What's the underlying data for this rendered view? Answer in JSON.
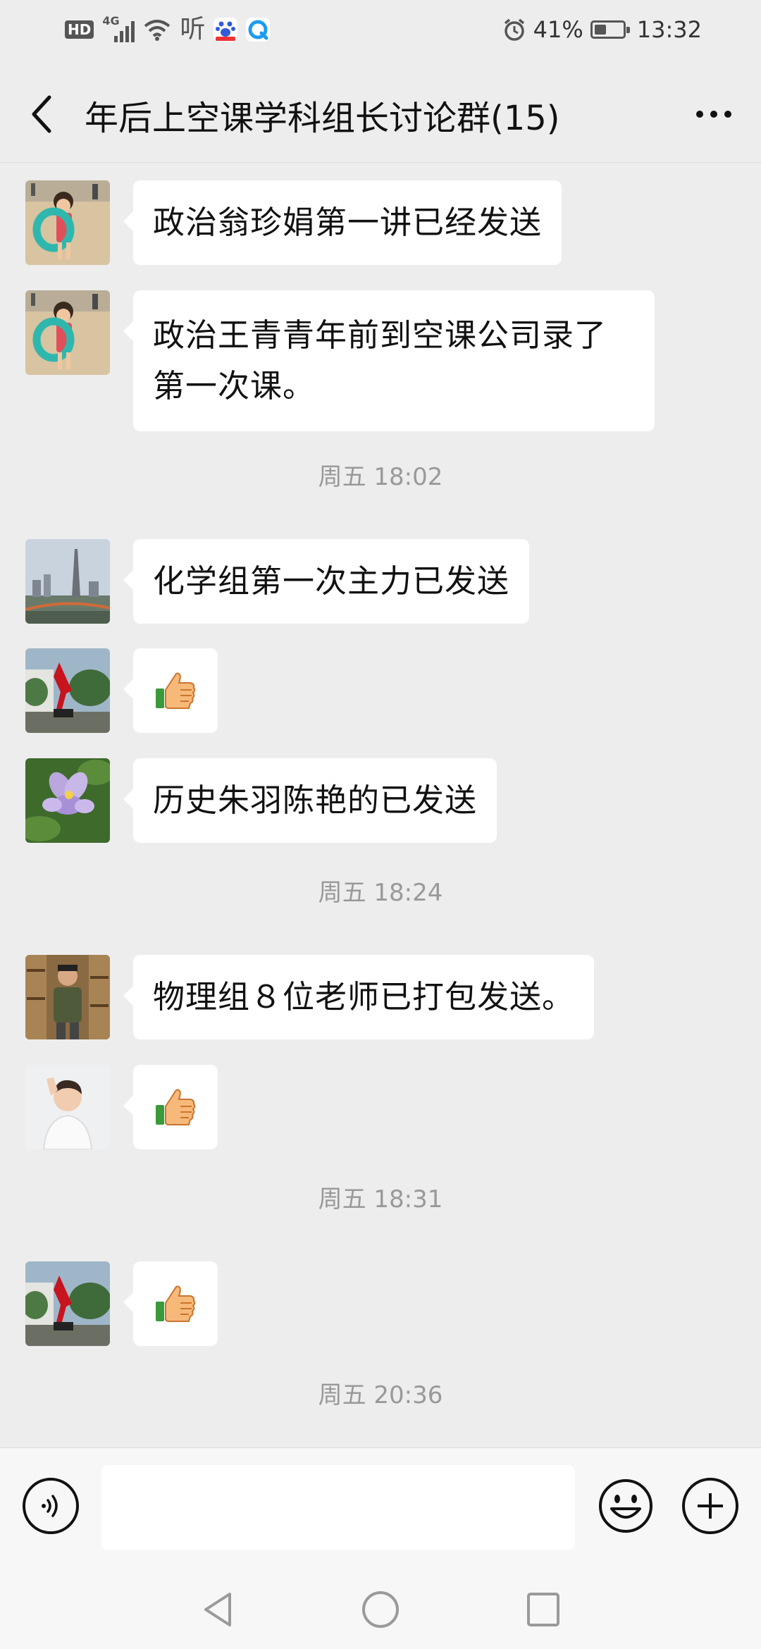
{
  "status_bar": {
    "network_badge": "HD",
    "signal_type": "4G",
    "app_glyph": "听",
    "icons": [
      "hd-icon",
      "signal-icon",
      "wifi-icon",
      "ting-app-icon",
      "baidu-app-icon",
      "browser-app-icon",
      "alarm-icon",
      "battery-icon"
    ],
    "battery_percent": "41%",
    "battery_level": 0.41,
    "time": "13:32"
  },
  "header": {
    "title": "年后上空课学科组长讨论群(15)",
    "back_icon": "chevron-left-icon",
    "more_icon": "more-dots-icon"
  },
  "messages": [
    {
      "type": "text",
      "avatar": "child-beach-avatar",
      "text": "政治翁珍娟第一讲已经发送"
    },
    {
      "type": "text",
      "avatar": "child-beach-avatar",
      "text": "政治王青青年前到空课公司录了第一次课。"
    },
    {
      "type": "time",
      "text": "周五 18:02"
    },
    {
      "type": "text",
      "avatar": "city-tower-avatar",
      "text": "化学组第一次主力已发送"
    },
    {
      "type": "emoji",
      "avatar": "red-sculpture-avatar",
      "emoji": "thumbs-up-emoji"
    },
    {
      "type": "text",
      "avatar": "purple-flower-avatar",
      "text": "历史朱羽陈艳的已发送"
    },
    {
      "type": "time",
      "text": "周五 18:24"
    },
    {
      "type": "text",
      "avatar": "man-bookshelf-avatar",
      "text": "物理组８位老师已打包发送。"
    },
    {
      "type": "emoji",
      "avatar": "boy-portrait-avatar",
      "emoji": "thumbs-up-emoji"
    },
    {
      "type": "time",
      "text": "周五 18:31"
    },
    {
      "type": "emoji",
      "avatar": "red-sculpture-avatar",
      "emoji": "thumbs-up-emoji"
    },
    {
      "type": "time",
      "text": "周五 20:36"
    }
  ],
  "input_bar": {
    "voice_icon": "voice-icon",
    "input_value": "",
    "emoji_icon": "smiley-icon",
    "plus_icon": "plus-icon"
  },
  "nav_bar": {
    "icons": [
      "back-triangle-icon",
      "home-circle-icon",
      "recents-square-icon"
    ]
  },
  "colors": {
    "background": "#ededed",
    "bubble": "#ffffff",
    "timestamp_text": "#999999",
    "bar_background": "#f7f7f7"
  }
}
